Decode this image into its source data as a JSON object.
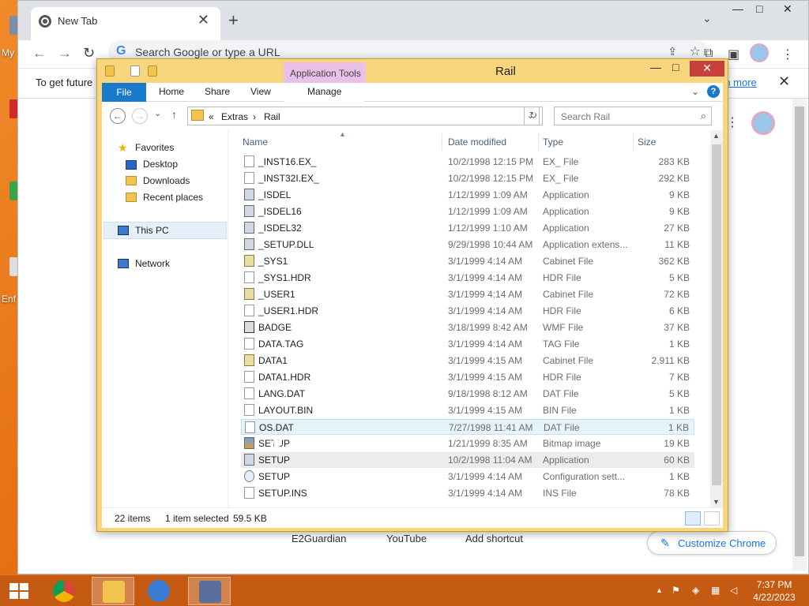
{
  "desktop": {
    "labels": [
      "My",
      "Enf"
    ]
  },
  "chrome": {
    "tab_title": "New Tab",
    "tab_close": "✕",
    "new_tab": "+",
    "tab_dropdown": "⌄",
    "win_minimize": "—",
    "win_maximize": "□",
    "win_close": "✕",
    "back": "←",
    "forward": "→",
    "reload": "↻",
    "omnibox_g": "G",
    "omnibox_placeholder": "Search Google or type a URL",
    "share": "⇪",
    "star": "☆",
    "extensions": "⧉",
    "sidepanel": "▣",
    "menu": "⋮",
    "infobar_text": "To get future",
    "infobar_link": "rn more",
    "infobar_close": "✕",
    "shortcuts": [
      "E2Guardian",
      "YouTube",
      "Add shortcut"
    ],
    "customize_label": "Customize Chrome",
    "customize_icon": "✎",
    "page_menu": "⋮"
  },
  "explorer": {
    "title": "Rail",
    "app_tools": "Application Tools",
    "ribbon_tabs": [
      "File",
      "Home",
      "Share",
      "View",
      "Manage"
    ],
    "ribbon_expand": "⌄",
    "help": "?",
    "win_minimize": "—",
    "win_maximize": "□",
    "win_close": "✕",
    "nav_back": "←",
    "nav_forward": "→",
    "nav_recent": "⌄",
    "nav_up": "↑",
    "address": {
      "prefix": "«",
      "crumb1": "Extras",
      "sep": "›",
      "crumb2": "Rail",
      "dropdown": "⌄"
    },
    "refresh": "↻",
    "search_placeholder": "Search Rail",
    "search_icon": "⌕",
    "nav_pane": {
      "favorites": "Favorites",
      "desktop": "Desktop",
      "downloads": "Downloads",
      "recent": "Recent places",
      "this_pc": "This PC",
      "network": "Network"
    },
    "columns": {
      "name": "Name",
      "date": "Date modified",
      "type": "Type",
      "size": "Size"
    },
    "sort_caret": "▲",
    "files": [
      {
        "name": "_INST16.EX_",
        "date": "10/2/1998 12:15 PM",
        "type": "EX_ File",
        "size": "283 KB",
        "icon": "file-icon"
      },
      {
        "name": "_INST32I.EX_",
        "date": "10/2/1998 12:15 PM",
        "type": "EX_ File",
        "size": "292 KB",
        "icon": "file-icon"
      },
      {
        "name": "_ISDEL",
        "date": "1/12/1999 1:09 AM",
        "type": "Application",
        "size": "9 KB",
        "icon": "application-icon"
      },
      {
        "name": "_ISDEL16",
        "date": "1/12/1999 1:09 AM",
        "type": "Application",
        "size": "9 KB",
        "icon": "application-icon"
      },
      {
        "name": "_ISDEL32",
        "date": "1/12/1999 1:10 AM",
        "type": "Application",
        "size": "27 KB",
        "icon": "application-icon"
      },
      {
        "name": "_SETUP.DLL",
        "date": "9/29/1998 10:44 AM",
        "type": "Application extens...",
        "size": "11 KB",
        "icon": "dll-icon"
      },
      {
        "name": "_SYS1",
        "date": "3/1/1999 4:14 AM",
        "type": "Cabinet File",
        "size": "362 KB",
        "icon": "cabinet-icon"
      },
      {
        "name": "_SYS1.HDR",
        "date": "3/1/1999 4:14 AM",
        "type": "HDR File",
        "size": "5 KB",
        "icon": "file-icon"
      },
      {
        "name": "_USER1",
        "date": "3/1/1999 4:14 AM",
        "type": "Cabinet File",
        "size": "72 KB",
        "icon": "cabinet-icon"
      },
      {
        "name": "_USER1.HDR",
        "date": "3/1/1999 4:14 AM",
        "type": "HDR File",
        "size": "6 KB",
        "icon": "file-icon"
      },
      {
        "name": "BADGE",
        "date": "3/18/1999 8:42 AM",
        "type": "WMF File",
        "size": "37 KB",
        "icon": "wmf-icon"
      },
      {
        "name": "DATA.TAG",
        "date": "3/1/1999 4:14 AM",
        "type": "TAG File",
        "size": "1 KB",
        "icon": "file-icon"
      },
      {
        "name": "DATA1",
        "date": "3/1/1999 4:15 AM",
        "type": "Cabinet File",
        "size": "2,911 KB",
        "icon": "cabinet-icon"
      },
      {
        "name": "DATA1.HDR",
        "date": "3/1/1999 4:15 AM",
        "type": "HDR File",
        "size": "7 KB",
        "icon": "file-icon"
      },
      {
        "name": "LANG.DAT",
        "date": "9/18/1998 8:12 AM",
        "type": "DAT File",
        "size": "5 KB",
        "icon": "file-icon"
      },
      {
        "name": "LAYOUT.BIN",
        "date": "3/1/1999 4:15 AM",
        "type": "BIN File",
        "size": "1 KB",
        "icon": "file-icon"
      },
      {
        "name": "OS.DAT",
        "date": "7/27/1998 11:41 AM",
        "type": "DAT File",
        "size": "1 KB",
        "icon": "file-icon",
        "state": "hover"
      },
      {
        "name": "SETUP",
        "date": "1/21/1999 8:35 AM",
        "type": "Bitmap image",
        "size": "19 KB",
        "icon": "bitmap-icon"
      },
      {
        "name": "SETUP",
        "date": "10/2/1998 11:04 AM",
        "type": "Application",
        "size": "60 KB",
        "icon": "application-icon",
        "state": "selected"
      },
      {
        "name": "SETUP",
        "date": "3/1/1999 4:14 AM",
        "type": "Configuration sett...",
        "size": "1 KB",
        "icon": "config-icon"
      },
      {
        "name": "SETUP.INS",
        "date": "3/1/1999 4:14 AM",
        "type": "INS File",
        "size": "78 KB",
        "icon": "file-icon"
      }
    ],
    "status": {
      "items": "22 items",
      "selected": "1 item selected",
      "size": "59.5 KB"
    },
    "scroll_up": "▲",
    "scroll_down": "▼"
  },
  "taskbar": {
    "tray_up": "▲",
    "tray_flag": "⚑",
    "tray_net": "▦",
    "tray_vol": "◁",
    "time": "7:37 PM",
    "date": "4/22/2023"
  }
}
